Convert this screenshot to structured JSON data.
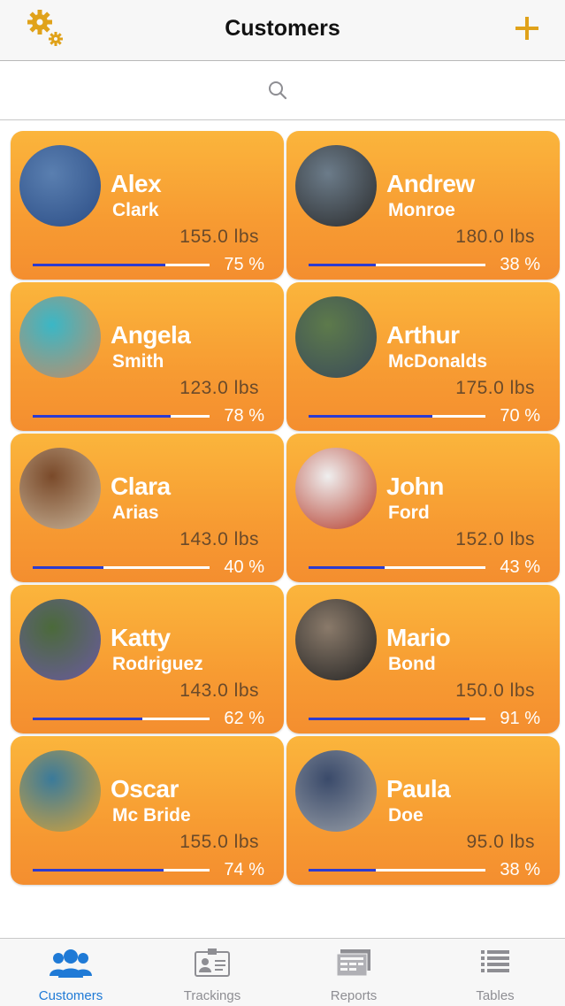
{
  "header": {
    "title": "Customers",
    "settings_icon": "gear-icon",
    "add_icon": "plus-icon",
    "accent": "#e0a21a"
  },
  "search": {
    "placeholder": "",
    "icon": "search-icon"
  },
  "customers": [
    {
      "first": "Alex",
      "last": "Clark",
      "weight": "155.0 lbs",
      "percent": "75 %",
      "progress": 75,
      "photo": [
        "#5a7fb0",
        "#2b4d86"
      ]
    },
    {
      "first": "Andrew",
      "last": "Monroe",
      "weight": "180.0 lbs",
      "percent": "38 %",
      "progress": 38,
      "photo": [
        "#6c7c8a",
        "#2a2b2c"
      ]
    },
    {
      "first": "Angela",
      "last": "Smith",
      "weight": "123.0 lbs",
      "percent": "78 %",
      "progress": 78,
      "photo": [
        "#3ab7c6",
        "#c48c66"
      ]
    },
    {
      "first": "Arthur",
      "last": "McDonalds",
      "weight": "175.0 lbs",
      "percent": "70 %",
      "progress": 70,
      "photo": [
        "#5d7a4b",
        "#3a4a5a"
      ]
    },
    {
      "first": "Clara",
      "last": "Arias",
      "weight": "143.0 lbs",
      "percent": "40 %",
      "progress": 40,
      "photo": [
        "#7a4a2a",
        "#c9b59a"
      ]
    },
    {
      "first": "John",
      "last": "Ford",
      "weight": "152.0 lbs",
      "percent": "43 %",
      "progress": 43,
      "photo": [
        "#efefef",
        "#b43a2a"
      ]
    },
    {
      "first": "Katty",
      "last": "Rodriguez",
      "weight": "143.0 lbs",
      "percent": "62 %",
      "progress": 62,
      "photo": [
        "#4b6a3a",
        "#6b5aa0"
      ]
    },
    {
      "first": "Mario",
      "last": "Bond",
      "weight": "150.0 lbs",
      "percent": "91 %",
      "progress": 91,
      "photo": [
        "#8a7a6a",
        "#222222"
      ]
    },
    {
      "first": "Oscar",
      "last": "Mc Bride",
      "weight": "155.0 lbs",
      "percent": "74 %",
      "progress": 74,
      "photo": [
        "#3a7a9a",
        "#d7a43a"
      ]
    },
    {
      "first": "Paula",
      "last": "Doe",
      "weight": "95.0 lbs",
      "percent": "38 %",
      "progress": 38,
      "photo": [
        "#3a4a6a",
        "#9aa0a8"
      ]
    }
  ],
  "tabs": [
    {
      "label": "Customers",
      "icon": "users-icon",
      "active": true
    },
    {
      "label": "Trackings",
      "icon": "id-card-icon",
      "active": false
    },
    {
      "label": "Reports",
      "icon": "reports-icon",
      "active": false
    },
    {
      "label": "Tables",
      "icon": "list-icon",
      "active": false
    }
  ],
  "colors": {
    "card_top": "#fbb53c",
    "card_bottom": "#f48e2f",
    "progress_fill": "#2c3bd0",
    "tab_active": "#1f7ad6",
    "tab_inactive": "#8e8e93"
  }
}
